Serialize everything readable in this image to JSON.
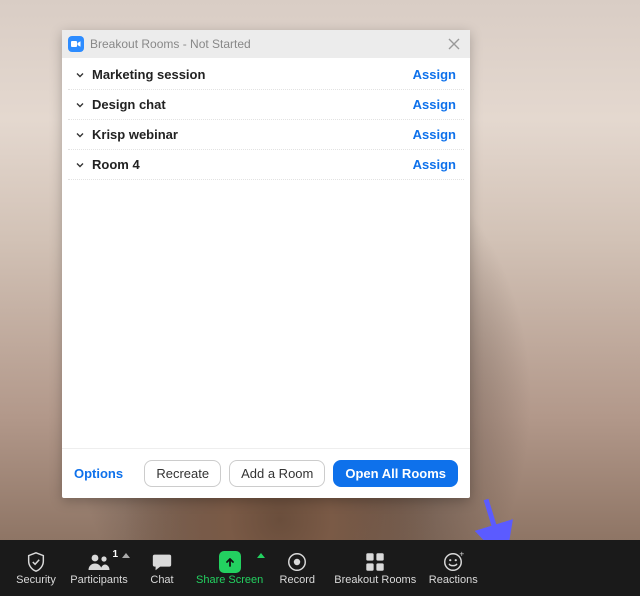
{
  "dialog": {
    "title": "Breakout Rooms - Not Started",
    "rooms": [
      {
        "name": "Marketing session",
        "assign": "Assign"
      },
      {
        "name": "Design chat",
        "assign": "Assign"
      },
      {
        "name": "Krisp webinar",
        "assign": "Assign"
      },
      {
        "name": "Room 4",
        "assign": "Assign"
      }
    ],
    "options_label": "Options",
    "recreate_label": "Recreate",
    "add_room_label": "Add a Room",
    "open_all_label": "Open All Rooms"
  },
  "toolbar": {
    "security": "Security",
    "participants": "Participants",
    "participants_count": "1",
    "chat": "Chat",
    "share": "Share Screen",
    "record": "Record",
    "breakout": "Breakout Rooms",
    "reactions": "Reactions"
  },
  "colors": {
    "accent": "#0e71eb",
    "share": "#23d160",
    "arrow": "#5b5bff"
  }
}
